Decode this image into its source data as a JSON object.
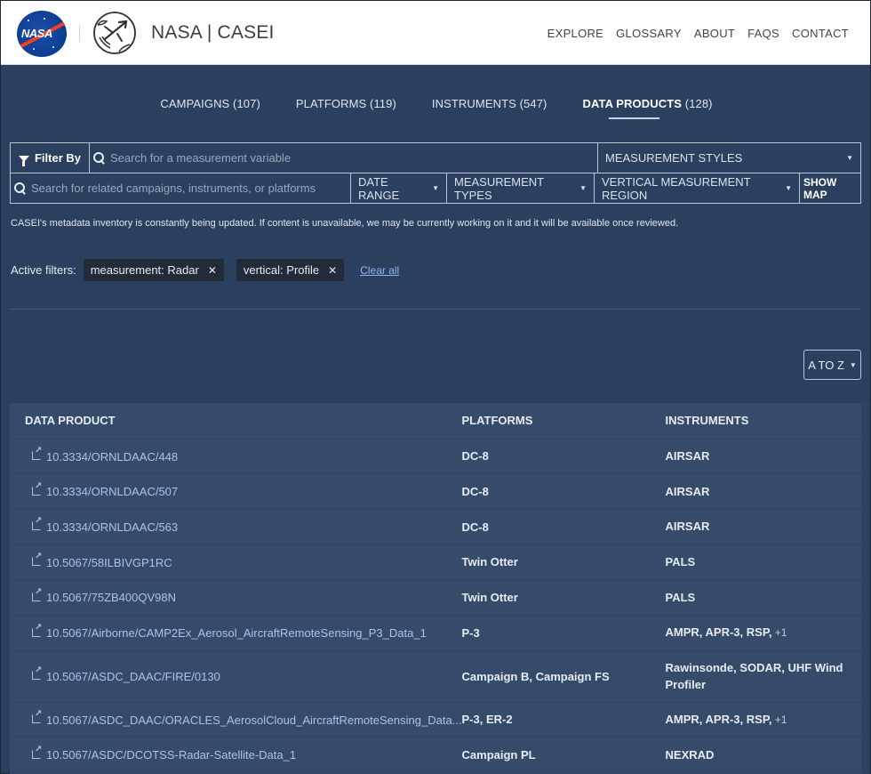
{
  "header": {
    "title": "NASA | CASEI",
    "nasa_logo_text": "NASA",
    "nav": [
      "EXPLORE",
      "GLOSSARY",
      "ABOUT",
      "FAQS",
      "CONTACT"
    ]
  },
  "category_tabs": [
    {
      "label": "CAMPAIGNS",
      "count": "(107)",
      "active": false
    },
    {
      "label": "PLATFORMS",
      "count": "(119)",
      "active": false
    },
    {
      "label": "INSTRUMENTS",
      "count": "(547)",
      "active": false
    },
    {
      "label": "DATA PRODUCTS",
      "count": "(128)",
      "active": true
    }
  ],
  "filters": {
    "filter_by_label": "Filter By",
    "measurement_search_placeholder": "Search for a measurement variable",
    "related_search_placeholder": "Search for related campaigns, instruments, or platforms",
    "measurement_styles": "MEASUREMENT STYLES",
    "date_range": "DATE RANGE",
    "measurement_types": "MEASUREMENT TYPES",
    "vertical_region": "VERTICAL MEASUREMENT REGION",
    "show_map": "SHOW MAP"
  },
  "notice": "CASEI's metadata inventory is constantly being updated. If content is unavailable, we may be currently working on it and it will be available once reviewed.",
  "active_filters": {
    "label": "Active filters:",
    "chips": [
      "measurement: Radar",
      "vertical: Profile"
    ],
    "clear_all": "Clear all"
  },
  "sort": {
    "selected": "A TO Z"
  },
  "table": {
    "columns": [
      "DATA PRODUCT",
      "PLATFORMS",
      "INSTRUMENTS"
    ],
    "rows": [
      {
        "product": "10.3334/ORNLDAAC/448",
        "platforms": "DC-8",
        "instruments": "AIRSAR",
        "more": ""
      },
      {
        "product": "10.3334/ORNLDAAC/507",
        "platforms": "DC-8",
        "instruments": "AIRSAR",
        "more": ""
      },
      {
        "product": "10.3334/ORNLDAAC/563",
        "platforms": "DC-8",
        "instruments": "AIRSAR",
        "more": ""
      },
      {
        "product": "10.5067/58ILBIVGP1RC",
        "platforms": "Twin Otter",
        "instruments": "PALS",
        "more": ""
      },
      {
        "product": "10.5067/75ZB400QV98N",
        "platforms": "Twin Otter",
        "instruments": "PALS",
        "more": ""
      },
      {
        "product": "10.5067/Airborne/CAMP2Ex_Aerosol_AircraftRemoteSensing_P3_Data_1",
        "platforms": "P-3",
        "instruments": "AMPR, APR-3, RSP,",
        "more": " +1"
      },
      {
        "product": "10.5067/ASDC_DAAC/FIRE/0130",
        "platforms": "Campaign B, Campaign FS",
        "instruments": "Rawinsonde, SODAR, UHF Wind Profiler",
        "more": ""
      },
      {
        "product": "10.5067/ASDC_DAAC/ORACLES_AerosolCloud_AircraftRemoteSensing_Data...",
        "platforms": "P-3, ER-2",
        "instruments": "AMPR, APR-3, RSP,",
        "more": " +1"
      },
      {
        "product": "10.5067/ASDC/DCOTSS-Radar-Satellite-Data_1",
        "platforms": "Campaign PL",
        "instruments": "NEXRAD",
        "more": ""
      }
    ]
  }
}
